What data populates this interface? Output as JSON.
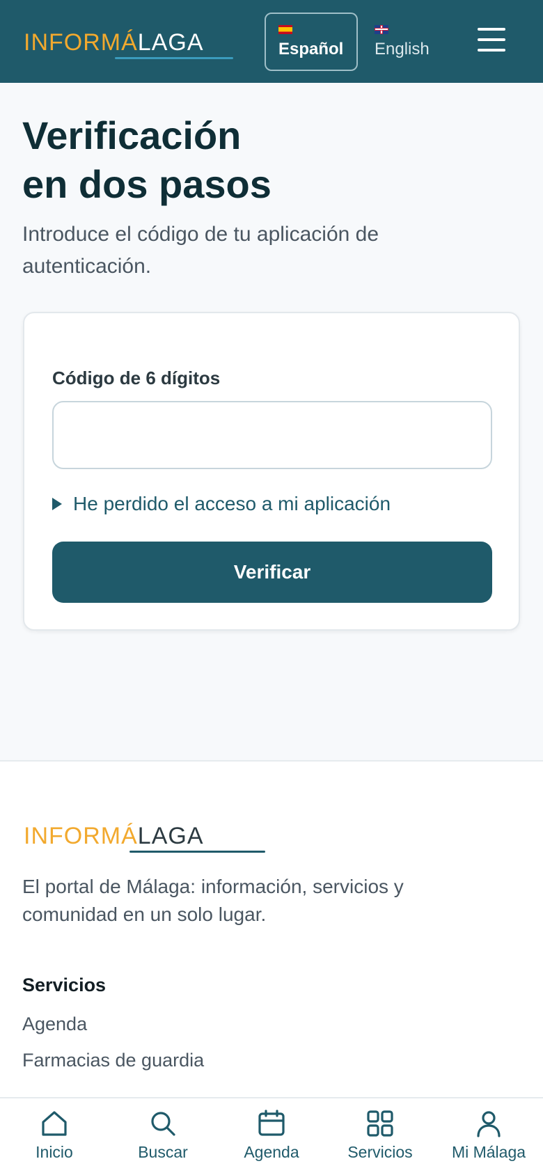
{
  "header": {
    "logo": {
      "part1": "INFORMÁ",
      "part2": "LAGA"
    },
    "languages": [
      {
        "label": "Español",
        "flag": "flag-es-icon",
        "active": true
      },
      {
        "label": "English",
        "flag": "flag-gb-icon",
        "active": false
      }
    ],
    "menu_icon": "hamburger-menu-icon"
  },
  "main": {
    "title_line1": "Verificación",
    "title_line2": "en dos pasos",
    "subtitle": "Introduce el código de tu aplicación de autenticación.",
    "form": {
      "code_label": "Código de 6 dígitos",
      "code_value": "",
      "lost_access": "He perdido el acceso a mi aplicación",
      "verify_label": "Verificar"
    }
  },
  "footer": {
    "logo": {
      "part1": "INFORMÁ",
      "part2": "LAGA"
    },
    "tagline": "El portal de Málaga: información, servicios y comunidad en un solo lugar.",
    "section_title": "Servicios",
    "links": [
      "Agenda",
      "Farmacias de guardia"
    ]
  },
  "bottom_nav": [
    {
      "label": "Inicio",
      "icon": "home-icon"
    },
    {
      "label": "Buscar",
      "icon": "search-icon"
    },
    {
      "label": "Agenda",
      "icon": "calendar-icon"
    },
    {
      "label": "Servicios",
      "icon": "grid-icon"
    },
    {
      "label": "Mi Málaga",
      "icon": "user-icon"
    }
  ],
  "colors": {
    "primary": "#1f5a6a",
    "accent": "#f2a92e",
    "background": "#f7f9fb"
  }
}
